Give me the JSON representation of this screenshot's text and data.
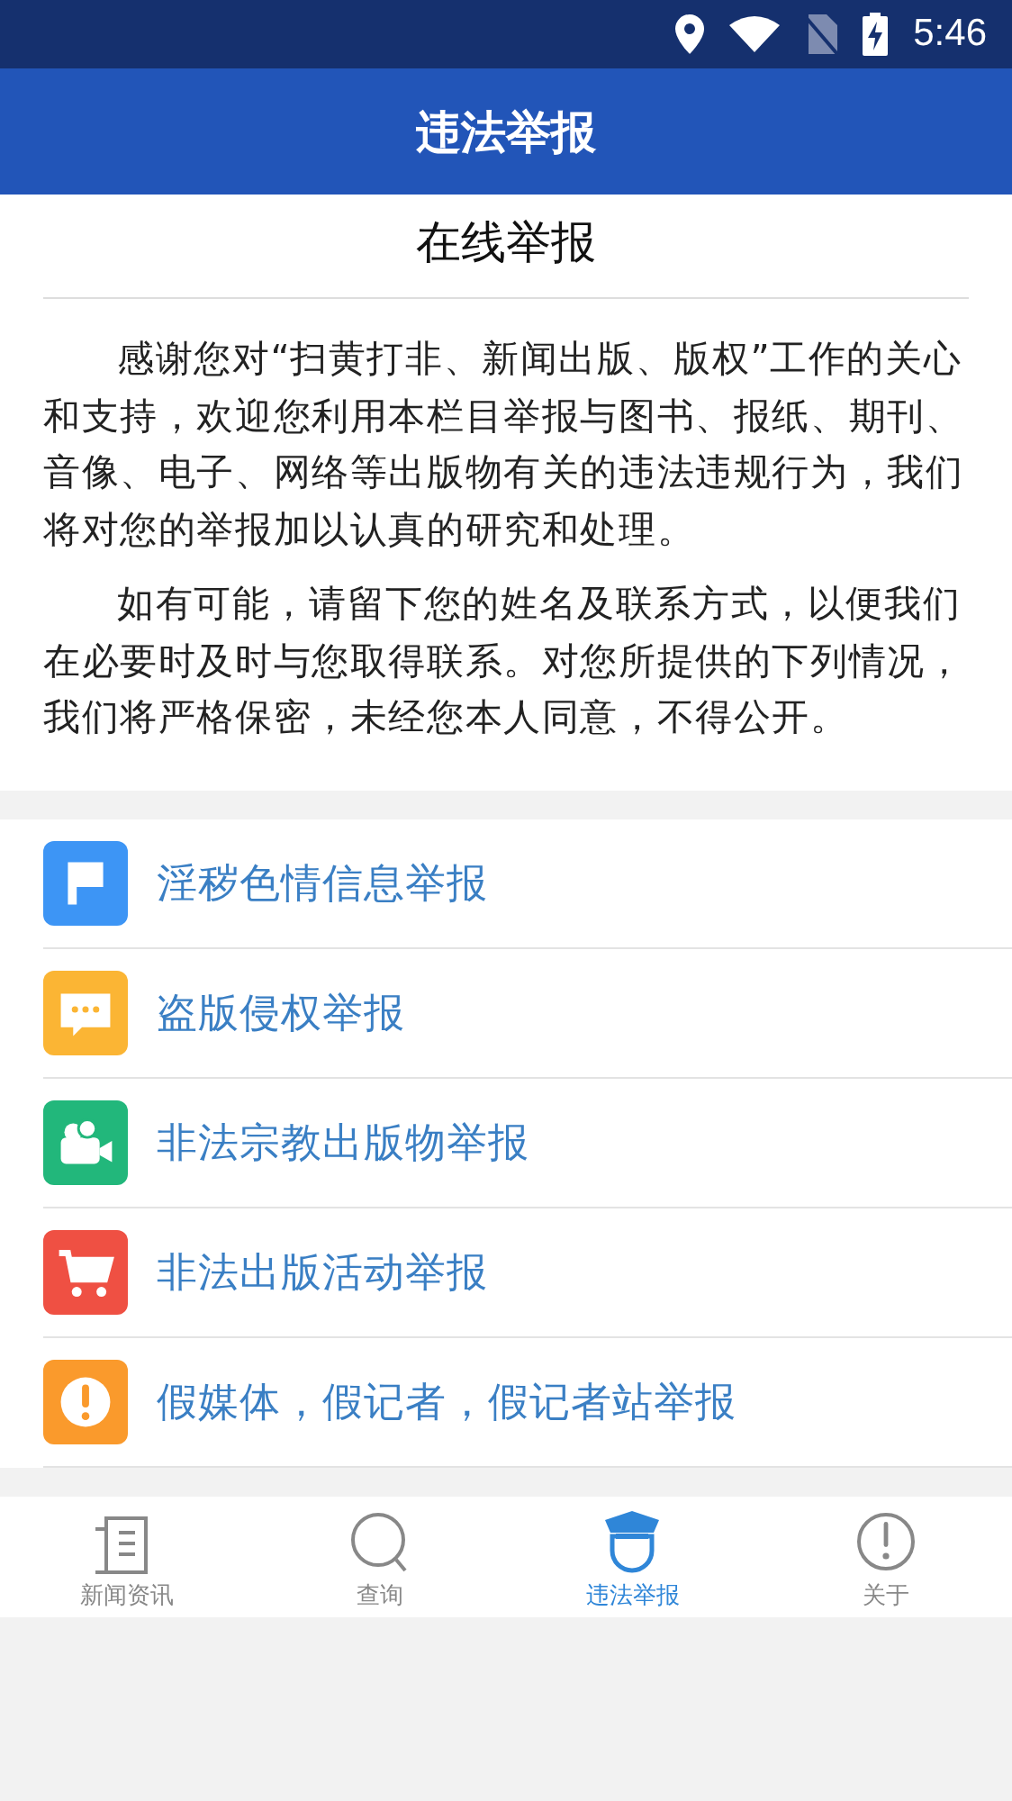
{
  "status_bar": {
    "time": "5:46"
  },
  "app_bar": {
    "title": "违法举报"
  },
  "intro": {
    "title": "在线举报",
    "paragraphs": [
      "感谢您对“扫黄打非、新闻出版、版权”工作的关心和支持，欢迎您利用本栏目举报与图书、报纸、期刊、音像、电子、网络等出版物有关的违法违规行为，我们将对您的举报加以认真的研究和处理。",
      "如有可能，请留下您的姓名及联系方式，以便我们在必要时及时与您取得联系。对您所提供的下列情况，我们将严格保密，未经您本人同意，不得公开。"
    ]
  },
  "report_items": [
    {
      "label": "淫秽色情信息举报",
      "kind": "flag",
      "color": "#3d95f5"
    },
    {
      "label": "盗版侵权举报",
      "kind": "chat",
      "color": "#fbb534"
    },
    {
      "label": "非法宗教出版物举报",
      "kind": "camera",
      "color": "#22b77b"
    },
    {
      "label": "非法出版活动举报",
      "kind": "cart",
      "color": "#ef5043"
    },
    {
      "label": "假媒体，假记者，假记者站举报",
      "kind": "alert",
      "color": "#fa9a2c"
    }
  ],
  "tabs": [
    {
      "label": "新闻资讯",
      "kind": "news",
      "selected": false
    },
    {
      "label": "查询",
      "kind": "search",
      "selected": false
    },
    {
      "label": "违法举报",
      "kind": "officer",
      "selected": true
    },
    {
      "label": "关于",
      "kind": "about",
      "selected": false
    }
  ]
}
